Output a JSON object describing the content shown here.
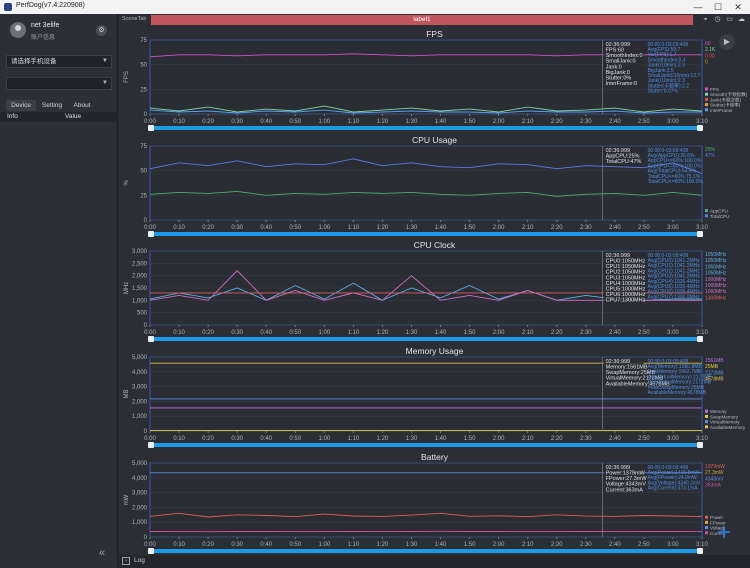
{
  "window": {
    "title": "PerfDog(v7.4.220908)",
    "min": "—",
    "max": "☐",
    "close": "✕"
  },
  "user": {
    "name": "net 3elife",
    "info": "账户信息"
  },
  "sidebar": {
    "device_select": "请选择手机设备",
    "app_select": "",
    "tabs": [
      "Device",
      "Setting",
      "About"
    ],
    "col_info": "Info",
    "col_value": "Value",
    "collapse": "«"
  },
  "topbar": {
    "scene_tab": "SceneTab",
    "label": "label1"
  },
  "bottom": {
    "log": "Log"
  },
  "x_ticks": [
    "0:00",
    "0:10",
    "0:20",
    "0:30",
    "0:40",
    "0:50",
    "1:00",
    "1:10",
    "1:20",
    "1:30",
    "1:40",
    "1:50",
    "2:00",
    "2:10",
    "2:20",
    "2:30",
    "2:40",
    "2:50",
    "3:00",
    "3:10"
  ],
  "panels": [
    {
      "title": "FPS",
      "ylabel": "FPS",
      "yticks": [
        "75",
        "50",
        "25",
        "0"
      ],
      "ymax": 75,
      "info_time": "02:36:999",
      "info_lines": [
        "FPS:60",
        "SmoothIndex:0",
        "SmallJank:0",
        "Jank:0",
        "BigJank:0",
        "Stutter:0%",
        "InterFrame:0"
      ],
      "avg_time": "00:00:0-03:09:408",
      "avg_lines": [
        "Avg(FPS):59.7",
        "Var(FPS):1.7",
        "SmoothIndex:0.4",
        "Jank(/10min):2.3",
        "BigJank:3.5",
        "SmallJank(/10min):12.7",
        "Jank(/10min):2.3",
        "Stutter(卡顿率):2.2",
        "Stutter:0.07%"
      ],
      "legend": [
        {
          "v": "60",
          "name": "FPS",
          "color": "#d94fd0"
        },
        {
          "v": "2.1K",
          "name": "Smooth(卡顿指数)",
          "color": "#7fd6a0"
        },
        {
          "v": "0.00",
          "name": "Jank(卡顿次数)",
          "color": "#e05050"
        },
        {
          "v": "0",
          "name": "Stutter(卡顿率)",
          "color": "#e8a030"
        },
        {
          "v": "",
          "name": "InterFrame",
          "color": "#5aa0f0"
        }
      ]
    },
    {
      "title": "CPU Usage",
      "ylabel": "%",
      "yticks": [
        "75",
        "50",
        "25",
        "0"
      ],
      "ymax": 75,
      "info_time": "02:36:999",
      "info_lines": [
        "AppCPU:25%",
        "TotalCPU:47%"
      ],
      "avg_time": "00:00:0-03:09:408",
      "avg_lines": [
        "Avg(AppCPU):26.6%",
        "AppCPU<=60%:100.0%",
        "AppCPU<=80%:100.0%",
        "Avg(TotalCPU):54.5%",
        "TotalCPU<=60%:75.1%",
        "TotalCPU<=80%:100.0%"
      ],
      "legend": [
        {
          "v": "25%",
          "name": "AppCPU",
          "color": "#4caf6e"
        },
        {
          "v": "47%",
          "name": "TotalCPU",
          "color": "#5a7de8"
        }
      ]
    },
    {
      "title": "CPU Clock",
      "ylabel": "MHz",
      "yticks": [
        "3,000",
        "2,500",
        "2,000",
        "1,500",
        "1,000",
        "500",
        "0"
      ],
      "ymax": 3000,
      "info_time": "02:36:999",
      "info_lines": [
        "CPU0:1050MHz",
        "CPU1:1050MHz",
        "CPU2:1050MHz",
        "CPU3:1050MHz",
        "CPU4:1000MHz",
        "CPU5:1000MHz",
        "CPU6:1000MHz",
        "CPU7:1300MHz"
      ],
      "avg_time": "00:00:0-03:09:408",
      "avg_lines": [
        "Avg(CPU0):1041.2MHz",
        "Avg(CPU1):1041.2MHz",
        "Avg(CPU2):1041.2MHz",
        "Avg(CPU3):1041.2MHz",
        "Avg(CPU4):1026.4MHz",
        "Avg(CPU5):1026.4MHz",
        "Avg(CPU6):1026.4MHz",
        "Avg(CPU7):1300.0MHz"
      ],
      "legend": [
        {
          "v": "1050MHz",
          "name": "",
          "color": "#5ab0e8"
        },
        {
          "v": "1050MHz",
          "name": "",
          "color": "#5ab0e8"
        },
        {
          "v": "1050MHz",
          "name": "",
          "color": "#5ab0e8"
        },
        {
          "v": "1050MHz",
          "name": "",
          "color": "#5ab0e8"
        },
        {
          "v": "1000MHz",
          "name": "",
          "color": "#d070c8"
        },
        {
          "v": "1000MHz",
          "name": "",
          "color": "#d070c8"
        },
        {
          "v": "1000MHz",
          "name": "",
          "color": "#d070c8"
        },
        {
          "v": "1300MHz",
          "name": "",
          "color": "#e06060"
        }
      ]
    },
    {
      "title": "Memory Usage",
      "ylabel": "MB",
      "yticks": [
        "5,000",
        "4,000",
        "3,000",
        "2,000",
        "1,000",
        "0"
      ],
      "ymax": 5000,
      "info_time": "02:36:999",
      "info_lines": [
        "Memory:1561MB",
        "SwapMemory:25MB",
        "VirtualMemory:2172MB",
        "AvailableMemory:4578MB"
      ],
      "avg_time": "00:00:0-03:09:408",
      "avg_lines": [
        "Avg(Memory):1560.8MB",
        "PeakMemory:1562.7MB",
        "Avg(VirtualMemory):2172MB",
        "PeakVirtualMemory:2172MB",
        "PeakSwapMemory:25MB",
        "AvailableMemory:4578MB"
      ],
      "legend": [
        {
          "v": "1561MB",
          "name": "Memory",
          "color": "#c070e0"
        },
        {
          "v": "25MB",
          "name": "SwapMemory",
          "color": "#e0d040"
        },
        {
          "v": "2172MB",
          "name": "VirtualMemory",
          "color": "#5a90e8"
        },
        {
          "v": "4578MB",
          "name": "AvailableMemory",
          "color": "#e0c050"
        }
      ]
    },
    {
      "title": "Battery",
      "ylabel": "mW",
      "yticks": [
        "5,000",
        "4,000",
        "3,000",
        "2,000",
        "1,000",
        "0"
      ],
      "ymax": 5000,
      "info_time": "02:36:999",
      "info_lines": [
        "Power:1379mW",
        "FPower:27.3mW",
        "Voltage:4343mV",
        "Current:363mA"
      ],
      "avg_time": "00:00:0-03:09:408",
      "avg_lines": [
        "Avg(Power):1415.8mW",
        "Avg(FPower):24.0mW",
        "Avg(Voltage):4340.2mV",
        "Avg(Current):373.1mA"
      ],
      "legend": [
        {
          "v": "1379mW",
          "name": "Power",
          "color": "#e06050"
        },
        {
          "v": "27.3mW",
          "name": "FPower",
          "color": "#e0a040"
        },
        {
          "v": "4343mV",
          "name": "Voltage",
          "color": "#5a90e8"
        },
        {
          "v": "363mA",
          "name": "Current",
          "color": "#d050a0"
        }
      ]
    }
  ],
  "chart_data": [
    {
      "type": "line",
      "title": "FPS",
      "ylabel": "FPS",
      "ylim": [
        0,
        75
      ],
      "x": [
        "0:00",
        "0:10",
        "0:20",
        "0:30",
        "0:40",
        "0:50",
        "1:00",
        "1:10",
        "1:20",
        "1:30",
        "1:40",
        "1:50",
        "2:00",
        "2:10",
        "2:20",
        "2:30",
        "2:40",
        "2:50",
        "3:00",
        "3:10"
      ],
      "series": [
        {
          "name": "FPS",
          "values": [
            58,
            60,
            60,
            59,
            60,
            60,
            60,
            61,
            60,
            59,
            60,
            60,
            60,
            60,
            59,
            60,
            60,
            60,
            60,
            60
          ]
        },
        {
          "name": "Smooth(卡顿指数)",
          "values": [
            6,
            3,
            7,
            2,
            5,
            3,
            8,
            2,
            4,
            6,
            3,
            5,
            2,
            7,
            3,
            4,
            6,
            2,
            5,
            3
          ]
        },
        {
          "name": "InterFrame",
          "values": [
            4,
            2,
            3,
            1,
            3,
            2,
            4,
            1,
            2,
            3,
            2,
            2,
            1,
            3,
            2,
            2,
            3,
            1,
            2,
            2
          ]
        }
      ]
    },
    {
      "type": "line",
      "title": "CPU Usage",
      "ylabel": "%",
      "ylim": [
        0,
        75
      ],
      "x": [
        "0:00",
        "0:10",
        "0:20",
        "0:30",
        "0:40",
        "0:50",
        "1:00",
        "1:10",
        "1:20",
        "1:30",
        "1:40",
        "1:50",
        "2:00",
        "2:10",
        "2:20",
        "2:30",
        "2:40",
        "2:50",
        "3:00",
        "3:10"
      ],
      "series": [
        {
          "name": "TotalCPU",
          "values": [
            52,
            58,
            55,
            60,
            54,
            57,
            56,
            62,
            55,
            58,
            54,
            53,
            57,
            56,
            52,
            55,
            54,
            53,
            58,
            47
          ]
        },
        {
          "name": "AppCPU",
          "values": [
            26,
            28,
            27,
            29,
            25,
            27,
            26,
            28,
            27,
            28,
            26,
            25,
            27,
            28,
            24,
            26,
            27,
            25,
            28,
            25
          ]
        }
      ]
    },
    {
      "type": "line",
      "title": "CPU Clock",
      "ylabel": "MHz",
      "ylim": [
        0,
        3000
      ],
      "x": [
        "0:00",
        "0:10",
        "0:20",
        "0:30",
        "0:40",
        "0:50",
        "1:00",
        "1:10",
        "1:20",
        "1:30",
        "1:40",
        "1:50",
        "2:00",
        "2:10",
        "2:20",
        "2:30",
        "2:40",
        "2:50",
        "3:00",
        "3:10"
      ],
      "series": [
        {
          "name": "CPU0-3",
          "values": [
            1050,
            1300,
            1100,
            1500,
            1000,
            1600,
            1050,
            1700,
            1000,
            1500,
            1100,
            1600,
            1050,
            1400,
            1000,
            1200,
            1050,
            1000,
            1050,
            1050
          ]
        },
        {
          "name": "CPU4-6",
          "values": [
            1000,
            1200,
            1000,
            2200,
            1000,
            1400,
            1000,
            1300,
            1000,
            2000,
            1000,
            1200,
            1000,
            1400,
            1000,
            1000,
            1000,
            1000,
            1000,
            1000
          ]
        },
        {
          "name": "CPU7",
          "values": [
            1300,
            1300,
            1300,
            1300,
            1300,
            1300,
            1300,
            1300,
            1300,
            1300,
            1300,
            1300,
            1300,
            1300,
            1300,
            1300,
            1300,
            1300,
            1300,
            1300
          ]
        }
      ]
    },
    {
      "type": "line",
      "title": "Memory Usage",
      "ylabel": "MB",
      "ylim": [
        0,
        5000
      ],
      "x": [
        "0:00",
        "0:10",
        "0:20",
        "0:30",
        "0:40",
        "0:50",
        "1:00",
        "1:10",
        "1:20",
        "1:30",
        "1:40",
        "1:50",
        "2:00",
        "2:10",
        "2:20",
        "2:30",
        "2:40",
        "2:50",
        "3:00",
        "3:10"
      ],
      "series": [
        {
          "name": "AvailableMemory",
          "values": [
            4578,
            4578,
            4578,
            4578,
            4578,
            4578,
            4578,
            4578,
            4578,
            4578,
            4578,
            4578,
            4578,
            4578,
            4578,
            4578,
            4578,
            4578,
            4578,
            4578
          ]
        },
        {
          "name": "VirtualMemory",
          "values": [
            2172,
            2172,
            2172,
            2172,
            2172,
            2172,
            2172,
            2172,
            2172,
            2172,
            2172,
            2172,
            2172,
            2172,
            2172,
            2172,
            2172,
            2172,
            2172,
            2172
          ]
        },
        {
          "name": "Memory",
          "values": [
            1561,
            1561,
            1561,
            1561,
            1561,
            1561,
            1561,
            1561,
            1561,
            1561,
            1561,
            1561,
            1561,
            1561,
            1561,
            1561,
            1561,
            1561,
            1561,
            1561
          ]
        },
        {
          "name": "SwapMemory",
          "values": [
            25,
            25,
            25,
            25,
            25,
            25,
            25,
            25,
            25,
            25,
            25,
            25,
            25,
            25,
            25,
            25,
            25,
            25,
            25,
            25
          ]
        }
      ]
    },
    {
      "type": "line",
      "title": "Battery",
      "ylabel": "mW",
      "ylim": [
        0,
        5000
      ],
      "x": [
        "0:00",
        "0:10",
        "0:20",
        "0:30",
        "0:40",
        "0:50",
        "1:00",
        "1:10",
        "1:20",
        "1:30",
        "1:40",
        "1:50",
        "2:00",
        "2:10",
        "2:20",
        "2:30",
        "2:40",
        "2:50",
        "3:00",
        "3:10"
      ],
      "series": [
        {
          "name": "Voltage",
          "values": [
            4340,
            4340,
            4340,
            4340,
            4340,
            4340,
            4340,
            4340,
            4340,
            4340,
            4340,
            4340,
            4340,
            4340,
            4340,
            4340,
            4340,
            4340,
            4340,
            4343
          ]
        },
        {
          "name": "Power",
          "values": [
            1400,
            1600,
            1350,
            1500,
            1450,
            1380,
            1550,
            1420,
            1390,
            1480,
            1600,
            1400,
            1430,
            1370,
            1500,
            1410,
            1390,
            1450,
            1420,
            1379
          ]
        },
        {
          "name": "Current",
          "values": [
            370,
            380,
            360,
            375,
            372,
            365,
            378,
            370,
            368,
            374,
            382,
            369,
            371,
            366,
            376,
            370,
            368,
            373,
            370,
            363
          ]
        }
      ]
    }
  ],
  "colors": {
    "plot_border": "#3b62c8",
    "plot_bg": "#2a2d33",
    "grid": "#3a3e46",
    "info_text": "#4f8ee8"
  }
}
